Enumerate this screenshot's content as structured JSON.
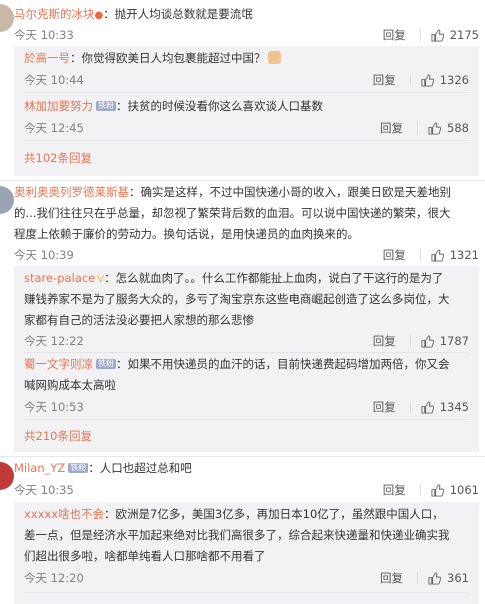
{
  "c1": {
    "user": "马尔克斯的冰块",
    "text": "：抛开人均谈总数就是要流氓",
    "time": "今天 10:33",
    "likes": "2175",
    "replies": [
      {
        "user": "於高一号",
        "text": "：你觉得欧美日人均包裹能超过中国？",
        "time": "今天 10:44",
        "likes": "1326"
      },
      {
        "user": "林加加要努力",
        "badge": "铁粉",
        "text": "：扶贫的时候没看你这么喜欢谈人口基数",
        "time": "今天 12:45",
        "likes": "588"
      }
    ],
    "more": "共102条回复"
  },
  "c2": {
    "user": "奥利奥奥列罗德莱斯基",
    "text_lines": [
      "：确实是这样，不过中国快递小哥的收入，跟美日欧是天差地别",
      "的...我们往往只在乎总量，却忽视了繁荣背后数的血泪。可以说中国快递的繁荣，很大",
      "程度上依赖于廉价的劳动力。换句话说，是用快递员的血肉换来的。"
    ],
    "time": "今天 10:39",
    "likes": "1321",
    "replies": [
      {
        "user": "stare-palace",
        "text_lines": [
          "：怎么就血肉了。。什么工作都能扯上血肉，说白了干这行的是为了",
          "赚钱养家不是为了服务大众的，多亏了淘宝京东这些电商崛起创造了这么多岗位，大",
          "家都有自己的活法没必要把人家想的那么悲惨"
        ],
        "time": "今天 12:22",
        "likes": "1787"
      },
      {
        "user": "蜀一文字则凉",
        "badge": "铁粉",
        "text_lines": [
          "：如果不用快递员的血汗的话，目前快递费起码增加两倍，你又会",
          "喊网购成本太高啦"
        ],
        "time": "今天 10:53",
        "likes": "1345"
      }
    ],
    "more": "共210条回复"
  },
  "c3": {
    "user": "Milan_YZ",
    "badge": "铁粉",
    "text": "：人口也超过总和吧",
    "time": "今天 10:35",
    "likes": "1061",
    "replies": [
      {
        "user": "xxxxx啥也不会",
        "text_lines": [
          "：欧洲是7亿多，美国3亿多，再加日本10亿了，虽然跟中国人口，",
          "差一点，但是经济水平加起来绝对比我们高很多了，综合起来快递量和快递业确实我",
          "们超出很多啦，啥都单纯看人口那啥都不用看了"
        ],
        "time": "今天 12:20",
        "likes": "361"
      }
    ]
  },
  "labels": {
    "reply": "回复"
  },
  "colors": {
    "name": "#eb7350",
    "sub_bg": "#f2f2f5",
    "meta": "#808080"
  },
  "icons": [
    "thumb-up-icon",
    "crown-icon",
    "avatar"
  ]
}
